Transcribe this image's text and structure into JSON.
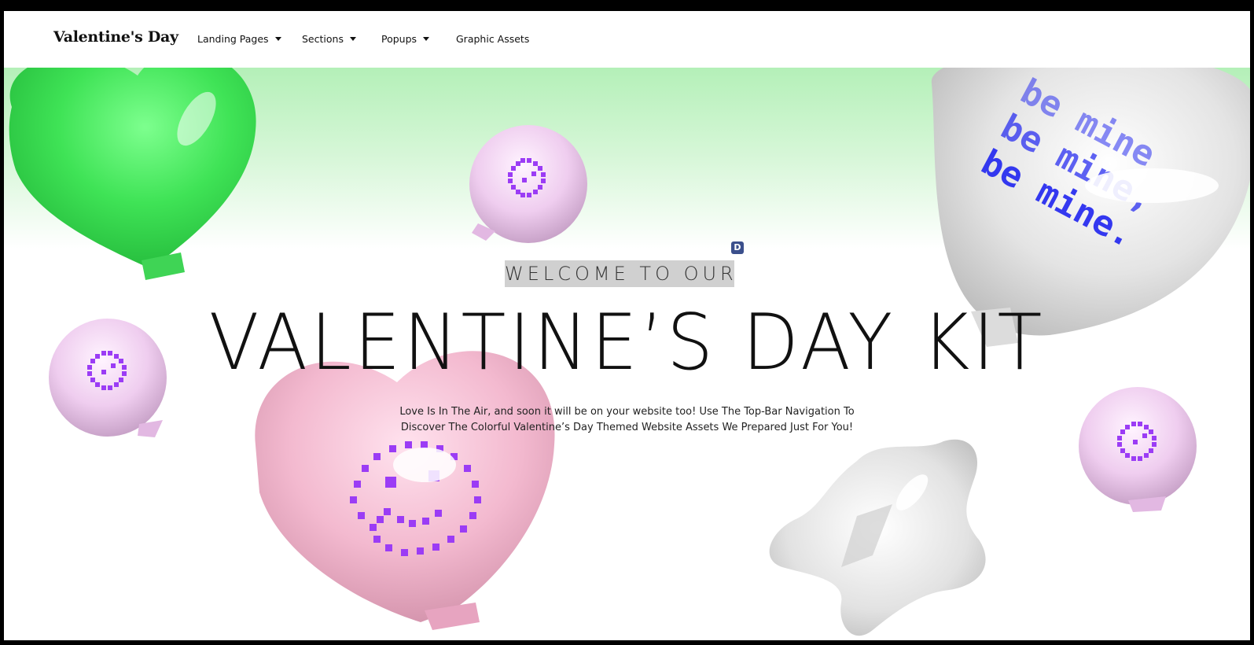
{
  "header": {
    "logo": "Valentine's Day",
    "nav": [
      {
        "label": "Landing Pages",
        "dropdown": true
      },
      {
        "label": "Sections",
        "dropdown": true
      },
      {
        "label": "Popups",
        "dropdown": true
      },
      {
        "label": "Graphic Assets",
        "dropdown": false
      }
    ]
  },
  "hero": {
    "kicker": "WELCOME TO OUR",
    "badge": "D",
    "title": "VALENTINE’S DAY KIT",
    "subtitle_line1": "Love Is In The Air, and soon it will be on your website too! Use The Top-Bar Navigation To",
    "subtitle_line2": "Discover The Colorful Valentine’s Day Themed Website Assets We Prepared Just For You!",
    "balloon_text": [
      "be mine",
      "be mine,",
      "be mine."
    ]
  },
  "colors": {
    "green_balloon": "#3ee85a",
    "pink_balloon": "#f3b9cf",
    "lilac_orb": "#f1d7f0",
    "pixel_purple": "#9b3cf5",
    "silver_balloon": "#e6e6e6",
    "text_blue": "#2a2ff0",
    "sky_green": "#b4f0b8"
  }
}
